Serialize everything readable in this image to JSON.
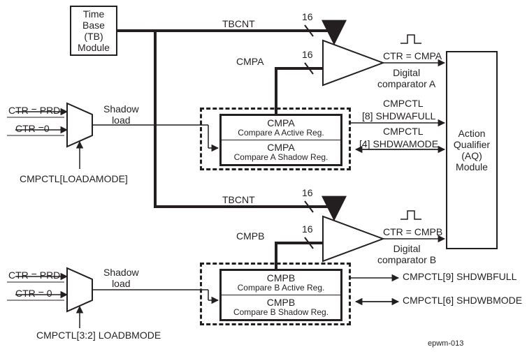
{
  "blocks": {
    "timebase": {
      "l1": "Time",
      "l2": "Base",
      "l3": "(TB)",
      "l4": "Module"
    },
    "aq": {
      "l1": "Action",
      "l2": "Qualifier",
      "l3": "(AQ)",
      "l4": "Module"
    }
  },
  "regA": {
    "active_name": "CMPA",
    "active_desc": "Compare A Active Reg.",
    "shadow_name": "CMPA",
    "shadow_desc": "Compare A Shadow Reg."
  },
  "regB": {
    "active_name": "CMPB",
    "active_desc": "Compare B Active Reg.",
    "shadow_name": "CMPB",
    "shadow_desc": "Compare B Shadow Reg."
  },
  "signals": {
    "tbcnt": "TBCNT",
    "cmpa": "CMPA",
    "cmpb": "CMPB",
    "bus16": "16",
    "ctr_eq_cmpa": "CTR = CMPA",
    "ctr_eq_cmpb": "CTR = CMPB",
    "comparatorA": "Digital\ncomparator A",
    "comparatorB": "Digital\ncomparator B",
    "ctr_prd": "CTR = PRD",
    "ctr_zero_a": "CTR =0",
    "ctr_zero_b": "CTR = 0",
    "shadow_load": "Shadow\nload",
    "loadamode": "CMPCTL[LOADAMODE]",
    "loadbmode": "CMPCTL[3:2] LOADBMODE",
    "cmpctl_l1": "CMPCTL",
    "shdwafull": "[8] SHDWAFULL",
    "shdwamode": "[4] SHDWAMODE",
    "shdwbfull": "CMPCTL[9] SHDWBFULL",
    "shdwbmode": "CMPCTL[6] SHDWBMODE",
    "figid": "epwm-013"
  }
}
